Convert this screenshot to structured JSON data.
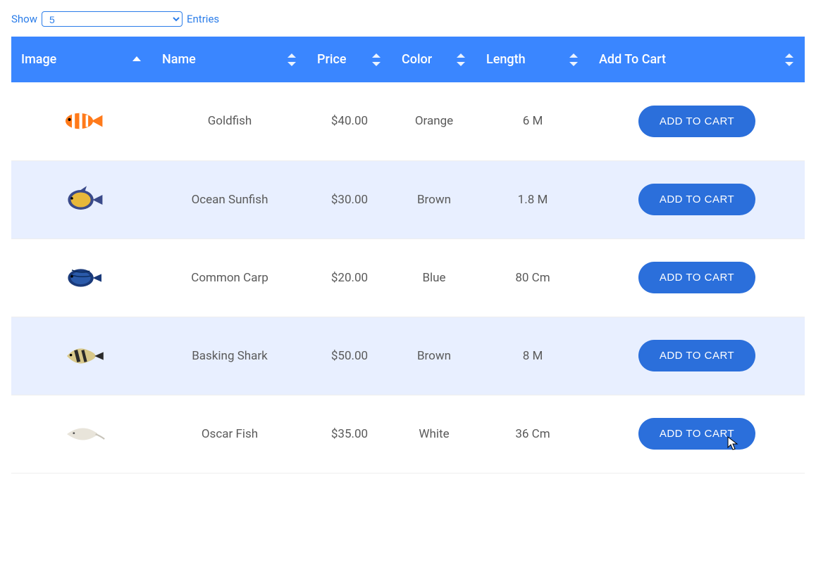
{
  "controls": {
    "show_label": "Show",
    "entries_label": "Entries",
    "selected_value": "5"
  },
  "columns": {
    "image": "Image",
    "name": "Name",
    "price": "Price",
    "color": "Color",
    "length": "Length",
    "add_to_cart": "Add To Cart"
  },
  "button_label": "ADD TO CART",
  "rows": [
    {
      "name": "Goldfish",
      "price": "$40.00",
      "color": "Orange",
      "length": "6 M",
      "fish": "clownfish"
    },
    {
      "name": "Ocean Sunfish",
      "price": "$30.00",
      "color": "Brown",
      "length": "1.8 M",
      "fish": "angelfish"
    },
    {
      "name": "Common Carp",
      "price": "$20.00",
      "color": "Blue",
      "length": "80 Cm",
      "fish": "bluefish"
    },
    {
      "name": "Basking Shark",
      "price": "$50.00",
      "color": "Brown",
      "length": "8 M",
      "fish": "triggerfish"
    },
    {
      "name": "Oscar Fish",
      "price": "$35.00",
      "color": "White",
      "length": "36 Cm",
      "fish": "ray"
    }
  ],
  "colors": {
    "header_bg": "#3a86ff",
    "button_bg": "#2b6fdb",
    "link": "#2b7de9",
    "row_alt": "#e8efff"
  }
}
